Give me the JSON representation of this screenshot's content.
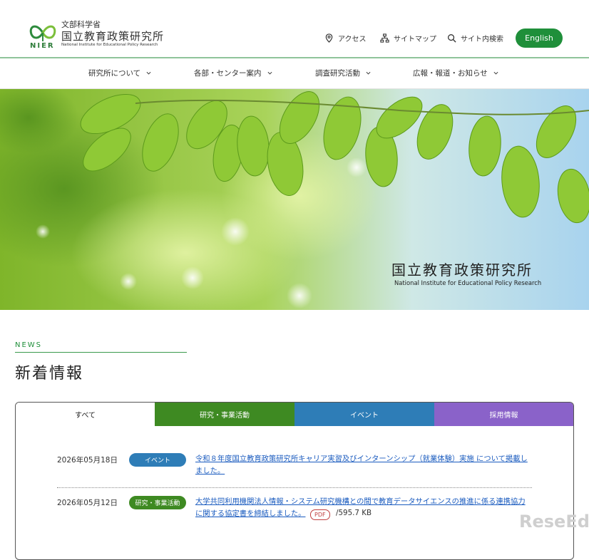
{
  "header": {
    "logo_ministry": "文部科学省",
    "logo_name": "国立教育政策研究所",
    "logo_en": "National Institute for Educational Policy Research",
    "logo_abbr": "NIER",
    "utility": [
      {
        "label": "アクセス",
        "icon": "map-pin-icon"
      },
      {
        "label": "サイトマップ",
        "icon": "sitemap-icon"
      },
      {
        "label": "サイト内検索",
        "icon": "search-icon"
      }
    ],
    "english_label": "English"
  },
  "nav": {
    "items": [
      {
        "label": "研究所について"
      },
      {
        "label": "各部・センター案内"
      },
      {
        "label": "調査研究活動"
      },
      {
        "label": "広報・報道・お知らせ"
      }
    ]
  },
  "hero": {
    "title": "国立教育政策研究所",
    "subtitle": "National Institute for Educational Policy Research"
  },
  "news": {
    "kicker": "NEWS",
    "title": "新着情報",
    "tabs": [
      {
        "label": "すべて",
        "color": "#ffffff"
      },
      {
        "label": "研究・事業活動",
        "color": "#3e8a22"
      },
      {
        "label": "イベント",
        "color": "#2e7db7"
      },
      {
        "label": "採用情報",
        "color": "#8a62c9"
      }
    ],
    "items": [
      {
        "date": "2026年05月18日",
        "category": "イベント",
        "category_color": "#2e7db7",
        "title_line1": "令和８年度国立教育政策研究所キャリア実習及びインターンシップ（就業体験）実施 について掲載し",
        "title_line2": "ました。"
      },
      {
        "date": "2026年05月12日",
        "category": "研究・事業活動",
        "category_color": "#3e8a22",
        "title_line1": "大学共同利用機関法人情報・システム研究機構との間で教育データサイエンスの推進に係る連携協力",
        "title_line2": "に関する協定書を締結しました。",
        "file_type": "PDF",
        "file_size": "/595.7 KB"
      }
    ]
  },
  "watermark": "ReseEd"
}
